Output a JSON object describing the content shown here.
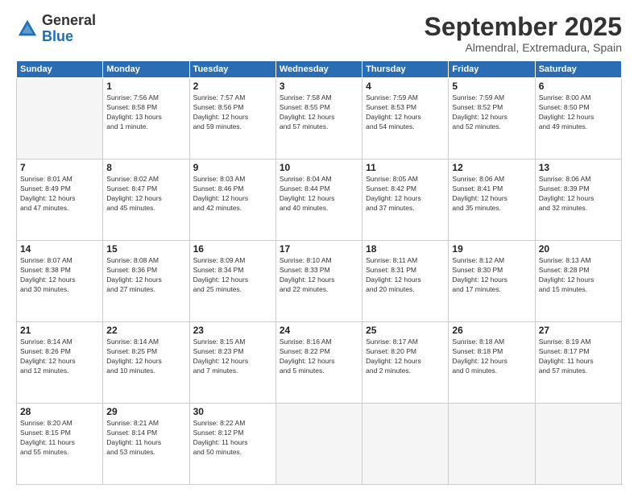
{
  "header": {
    "logo": {
      "general": "General",
      "blue": "Blue"
    },
    "title": "September 2025",
    "subtitle": "Almendral, Extremadura, Spain"
  },
  "weekdays": [
    "Sunday",
    "Monday",
    "Tuesday",
    "Wednesday",
    "Thursday",
    "Friday",
    "Saturday"
  ],
  "weeks": [
    [
      {
        "day": "",
        "info": ""
      },
      {
        "day": "1",
        "info": "Sunrise: 7:56 AM\nSunset: 8:58 PM\nDaylight: 13 hours\nand 1 minute."
      },
      {
        "day": "2",
        "info": "Sunrise: 7:57 AM\nSunset: 8:56 PM\nDaylight: 12 hours\nand 59 minutes."
      },
      {
        "day": "3",
        "info": "Sunrise: 7:58 AM\nSunset: 8:55 PM\nDaylight: 12 hours\nand 57 minutes."
      },
      {
        "day": "4",
        "info": "Sunrise: 7:59 AM\nSunset: 8:53 PM\nDaylight: 12 hours\nand 54 minutes."
      },
      {
        "day": "5",
        "info": "Sunrise: 7:59 AM\nSunset: 8:52 PM\nDaylight: 12 hours\nand 52 minutes."
      },
      {
        "day": "6",
        "info": "Sunrise: 8:00 AM\nSunset: 8:50 PM\nDaylight: 12 hours\nand 49 minutes."
      }
    ],
    [
      {
        "day": "7",
        "info": "Sunrise: 8:01 AM\nSunset: 8:49 PM\nDaylight: 12 hours\nand 47 minutes."
      },
      {
        "day": "8",
        "info": "Sunrise: 8:02 AM\nSunset: 8:47 PM\nDaylight: 12 hours\nand 45 minutes."
      },
      {
        "day": "9",
        "info": "Sunrise: 8:03 AM\nSunset: 8:46 PM\nDaylight: 12 hours\nand 42 minutes."
      },
      {
        "day": "10",
        "info": "Sunrise: 8:04 AM\nSunset: 8:44 PM\nDaylight: 12 hours\nand 40 minutes."
      },
      {
        "day": "11",
        "info": "Sunrise: 8:05 AM\nSunset: 8:42 PM\nDaylight: 12 hours\nand 37 minutes."
      },
      {
        "day": "12",
        "info": "Sunrise: 8:06 AM\nSunset: 8:41 PM\nDaylight: 12 hours\nand 35 minutes."
      },
      {
        "day": "13",
        "info": "Sunrise: 8:06 AM\nSunset: 8:39 PM\nDaylight: 12 hours\nand 32 minutes."
      }
    ],
    [
      {
        "day": "14",
        "info": "Sunrise: 8:07 AM\nSunset: 8:38 PM\nDaylight: 12 hours\nand 30 minutes."
      },
      {
        "day": "15",
        "info": "Sunrise: 8:08 AM\nSunset: 8:36 PM\nDaylight: 12 hours\nand 27 minutes."
      },
      {
        "day": "16",
        "info": "Sunrise: 8:09 AM\nSunset: 8:34 PM\nDaylight: 12 hours\nand 25 minutes."
      },
      {
        "day": "17",
        "info": "Sunrise: 8:10 AM\nSunset: 8:33 PM\nDaylight: 12 hours\nand 22 minutes."
      },
      {
        "day": "18",
        "info": "Sunrise: 8:11 AM\nSunset: 8:31 PM\nDaylight: 12 hours\nand 20 minutes."
      },
      {
        "day": "19",
        "info": "Sunrise: 8:12 AM\nSunset: 8:30 PM\nDaylight: 12 hours\nand 17 minutes."
      },
      {
        "day": "20",
        "info": "Sunrise: 8:13 AM\nSunset: 8:28 PM\nDaylight: 12 hours\nand 15 minutes."
      }
    ],
    [
      {
        "day": "21",
        "info": "Sunrise: 8:14 AM\nSunset: 8:26 PM\nDaylight: 12 hours\nand 12 minutes."
      },
      {
        "day": "22",
        "info": "Sunrise: 8:14 AM\nSunset: 8:25 PM\nDaylight: 12 hours\nand 10 minutes."
      },
      {
        "day": "23",
        "info": "Sunrise: 8:15 AM\nSunset: 8:23 PM\nDaylight: 12 hours\nand 7 minutes."
      },
      {
        "day": "24",
        "info": "Sunrise: 8:16 AM\nSunset: 8:22 PM\nDaylight: 12 hours\nand 5 minutes."
      },
      {
        "day": "25",
        "info": "Sunrise: 8:17 AM\nSunset: 8:20 PM\nDaylight: 12 hours\nand 2 minutes."
      },
      {
        "day": "26",
        "info": "Sunrise: 8:18 AM\nSunset: 8:18 PM\nDaylight: 12 hours\nand 0 minutes."
      },
      {
        "day": "27",
        "info": "Sunrise: 8:19 AM\nSunset: 8:17 PM\nDaylight: 11 hours\nand 57 minutes."
      }
    ],
    [
      {
        "day": "28",
        "info": "Sunrise: 8:20 AM\nSunset: 8:15 PM\nDaylight: 11 hours\nand 55 minutes."
      },
      {
        "day": "29",
        "info": "Sunrise: 8:21 AM\nSunset: 8:14 PM\nDaylight: 11 hours\nand 53 minutes."
      },
      {
        "day": "30",
        "info": "Sunrise: 8:22 AM\nSunset: 8:12 PM\nDaylight: 11 hours\nand 50 minutes."
      },
      {
        "day": "",
        "info": ""
      },
      {
        "day": "",
        "info": ""
      },
      {
        "day": "",
        "info": ""
      },
      {
        "day": "",
        "info": ""
      }
    ]
  ]
}
